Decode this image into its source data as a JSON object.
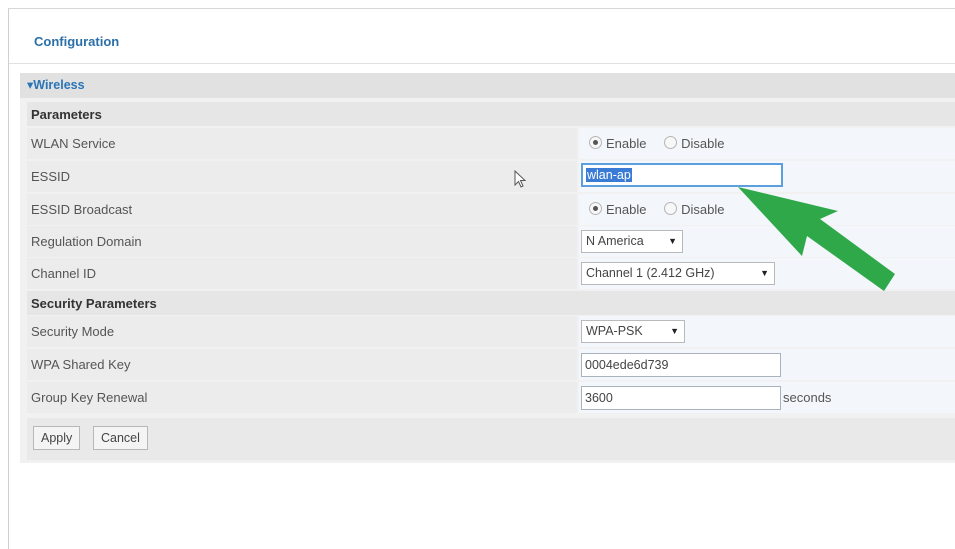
{
  "header": {
    "title": "Configuration"
  },
  "section": {
    "label": "▾Wireless"
  },
  "groups": {
    "parameters": "Parameters",
    "security": "Security Parameters"
  },
  "rows": {
    "wlan_service": {
      "label": "WLAN Service",
      "options": [
        "Enable",
        "Disable"
      ],
      "selected": "Enable"
    },
    "essid": {
      "label": "ESSID",
      "value": "wlan-ap"
    },
    "essid_broadcast": {
      "label": "ESSID Broadcast",
      "options": [
        "Enable",
        "Disable"
      ],
      "selected": "Enable"
    },
    "regulation_domain": {
      "label": "Regulation Domain",
      "value": "N America"
    },
    "channel_id": {
      "label": "Channel ID",
      "value": "Channel 1 (2.412 GHz)"
    },
    "security_mode": {
      "label": "Security Mode",
      "value": "WPA-PSK"
    },
    "wpa_shared_key": {
      "label": "WPA Shared Key",
      "value": "0004ede6d739"
    },
    "group_key_renewal": {
      "label": "Group Key Renewal",
      "value": "3600",
      "unit": "seconds"
    }
  },
  "buttons": {
    "apply": "Apply",
    "cancel": "Cancel"
  },
  "colors": {
    "accent": "#2a74b8",
    "arrow": "#2fa84a"
  },
  "icons": {
    "arrow_dropdown": "dropdown-arrow-icon",
    "pointer": "mouse-cursor-icon",
    "annotation": "green-arrow-annotation"
  }
}
